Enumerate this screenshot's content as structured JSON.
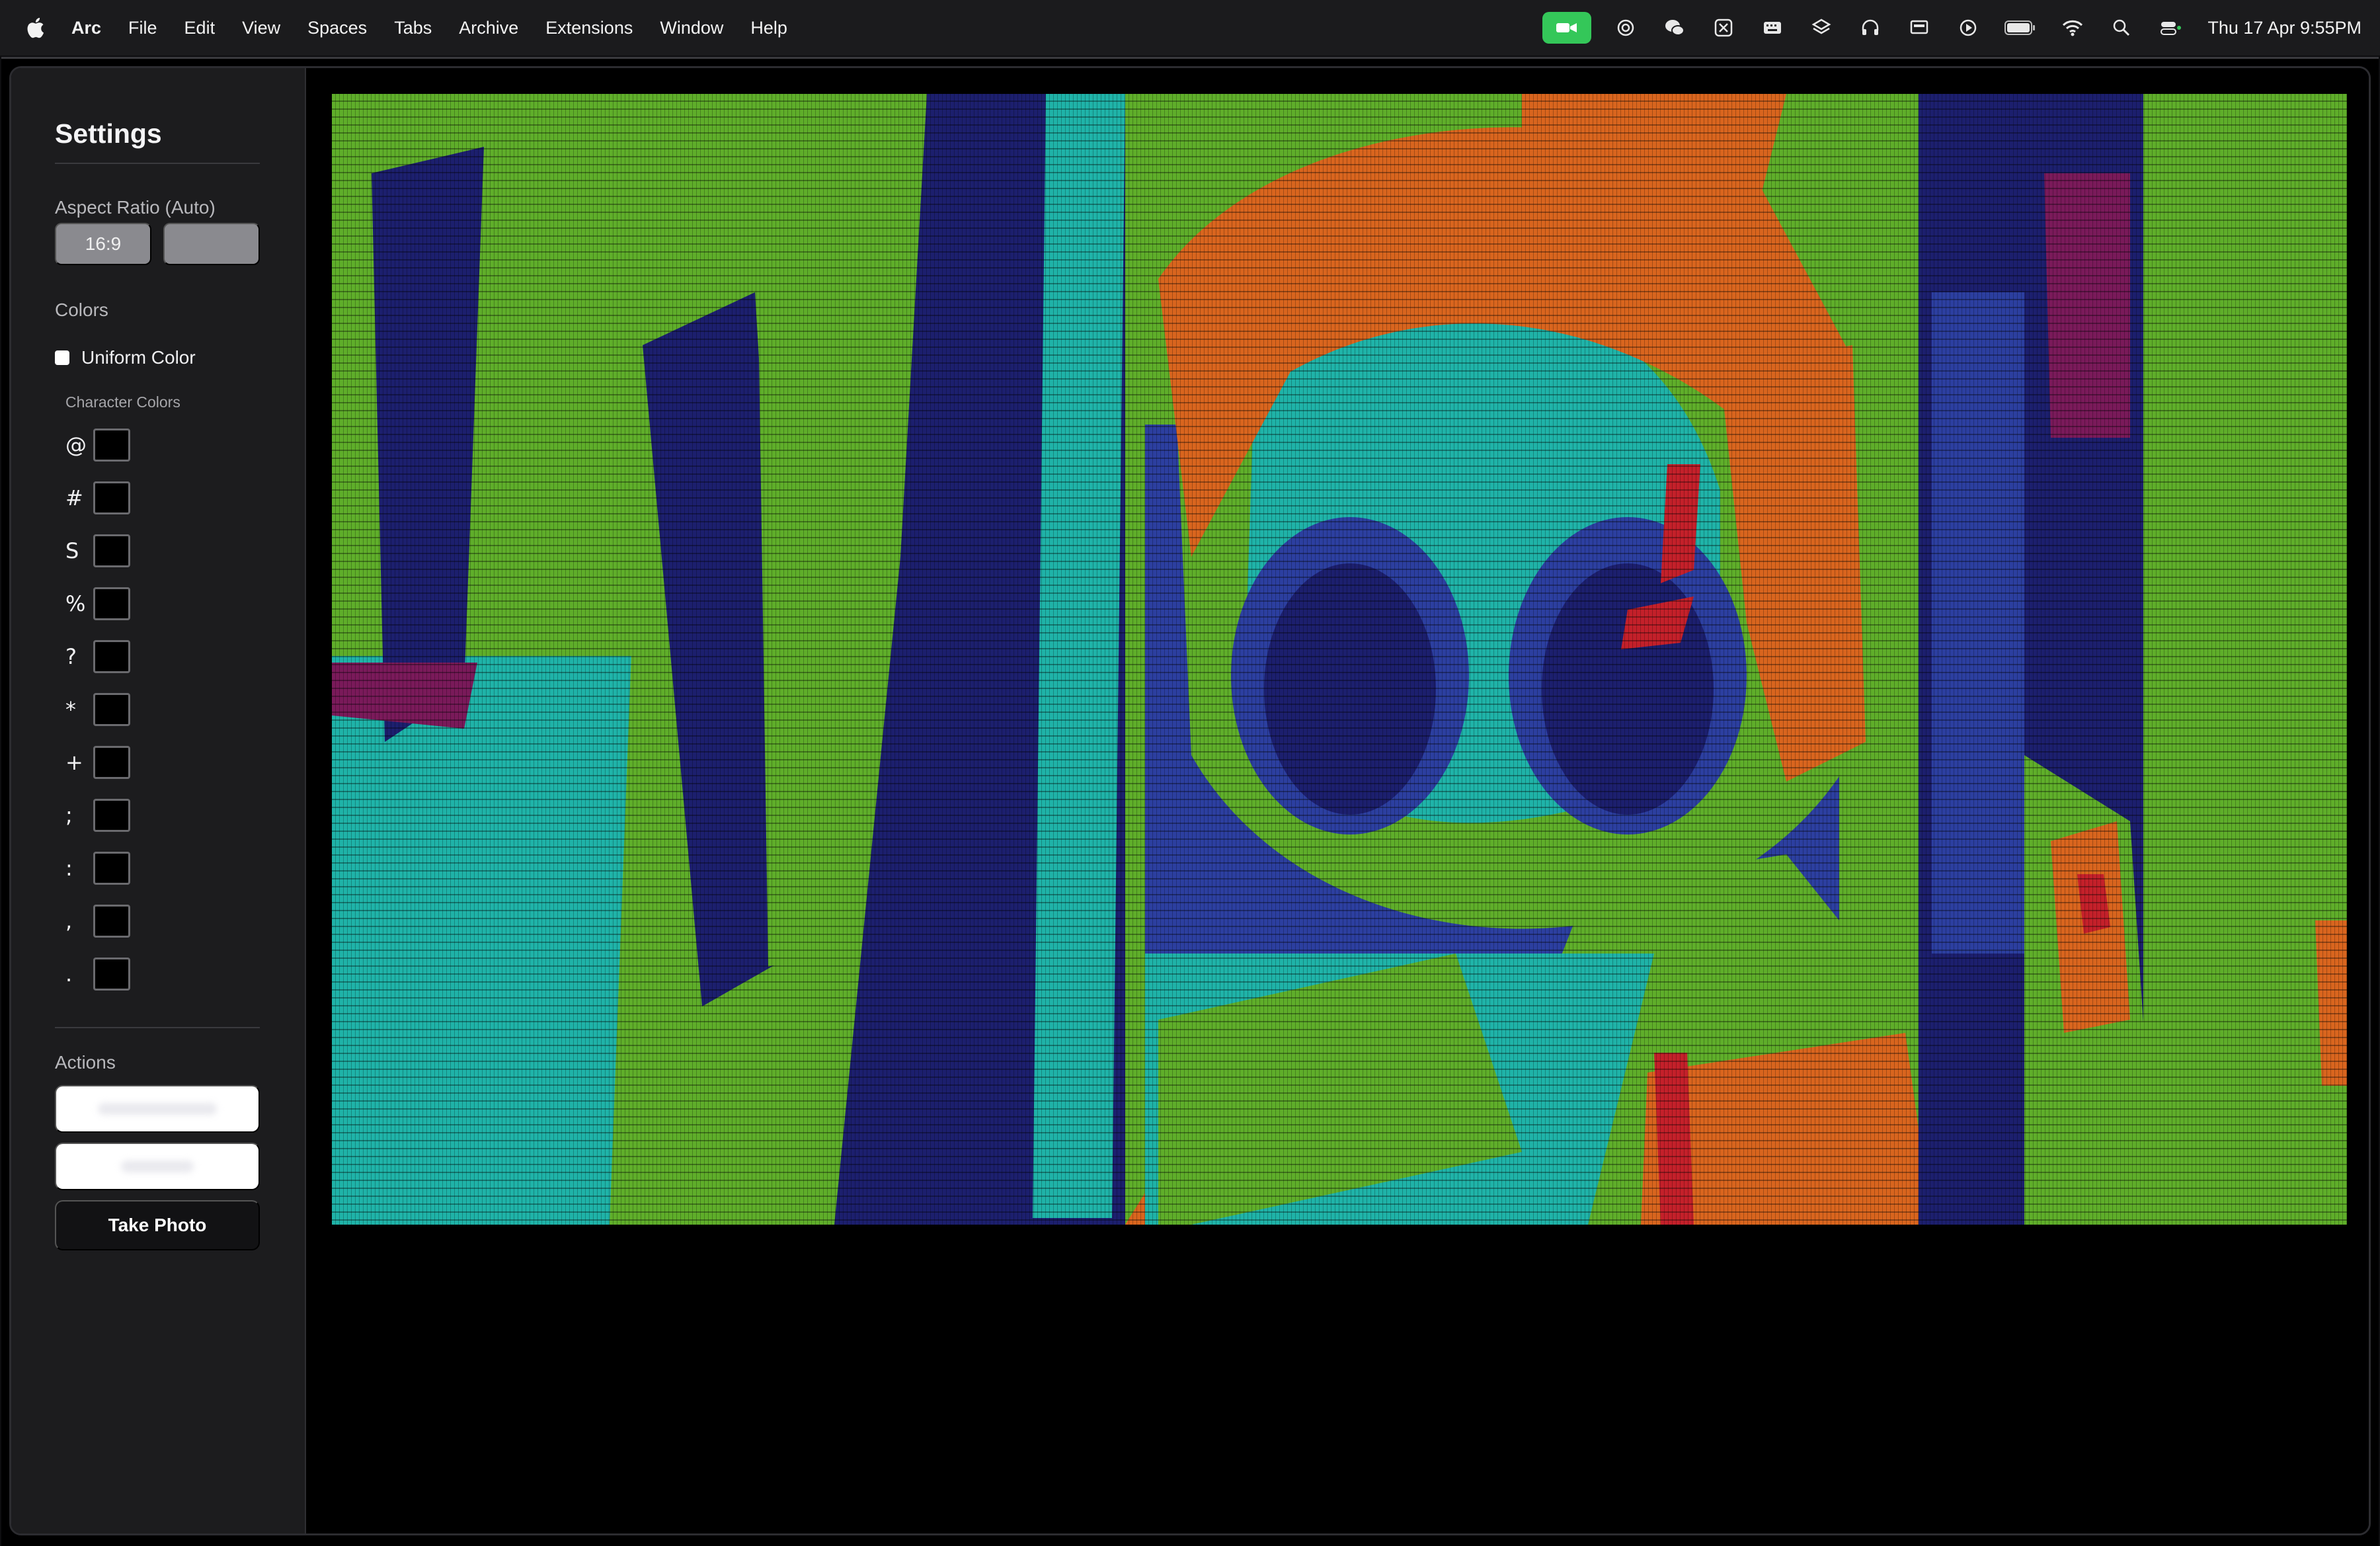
{
  "menubar": {
    "app_name": "Arc",
    "items": [
      "File",
      "Edit",
      "View",
      "Spaces",
      "Tabs",
      "Archive",
      "Extensions",
      "Window",
      "Help"
    ],
    "clock": "Thu 17 Apr  9:55PM",
    "tray_icons": [
      "facetime-icon",
      "chatgpt-icon",
      "wechat-icon",
      "grid-app-icon",
      "keyboard-icon",
      "layers-icon",
      "headphones-icon",
      "display-icon",
      "play-icon",
      "battery-icon",
      "wifi-icon",
      "spotlight-icon",
      "control-center-icon"
    ]
  },
  "sidebar": {
    "title": "Settings",
    "aspect_ratio_label": "Aspect Ratio (Auto)",
    "aspect_ratio_options": [
      "16:9",
      ""
    ],
    "colors_label": "Colors",
    "uniform_color_label": "Uniform Color",
    "uniform_color_checked": false,
    "character_colors_label": "Character Colors",
    "characters": [
      "@",
      "#",
      "S",
      "%",
      "?",
      "*",
      "+",
      ";",
      ":",
      ",",
      "."
    ],
    "swatch_color": "#000000",
    "actions_label": "Actions",
    "take_photo_label": "Take Photo"
  },
  "preview": {
    "palette": {
      "green": "#5fae2a",
      "cyan": "#1fb3a8",
      "navy": "#1c1f6e",
      "blue": "#2c3fa0",
      "orange": "#d9651e",
      "red": "#c4202a",
      "magenta": "#7a1a5a"
    }
  }
}
